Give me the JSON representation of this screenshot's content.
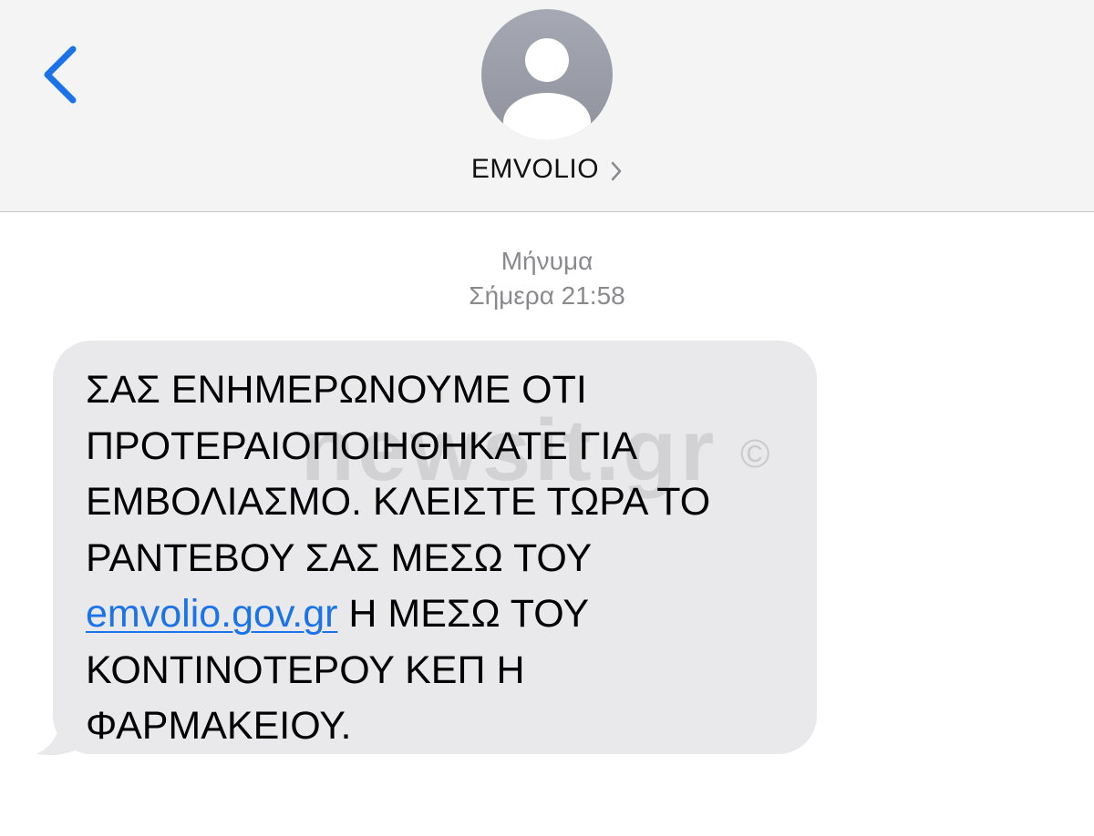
{
  "header": {
    "contact_name": "EMVOLIO",
    "back_icon": "chevron-left-icon",
    "avatar_icon": "person-silhouette-icon",
    "accent_color": "#1a73e8"
  },
  "thread": {
    "label": "Μήνυμα",
    "timestamp": "Σήμερα 21:58"
  },
  "message": {
    "part1": "ΣΑΣ ΕΝΗΜΕΡΩΝΟΥΜΕ ΟΤΙ\nΠΡΟΤΕΡΑΙΟΠΟΙΗΘΗΚΑΤΕ ΓΙΑ\nΕΜΒΟΛΙΑΣΜΟ. ΚΛΕΙΣΤΕ ΤΩΡΑ ΤΟ\nΡΑΝΤΕΒΟΥ ΣΑΣ ΜΕΣΩ ΤΟΥ\n",
    "link": "emvolio.gov.gr",
    "part2": " Η ΜΕΣΩ ΤΟΥ\nΚΟΝΤΙΝΟΤΕΡΟΥ ΚΕΠ Η\nΦΑΡΜΑΚΕΙΟΥ."
  },
  "watermark": {
    "text": "newsit.gr",
    "copyright": "©"
  }
}
